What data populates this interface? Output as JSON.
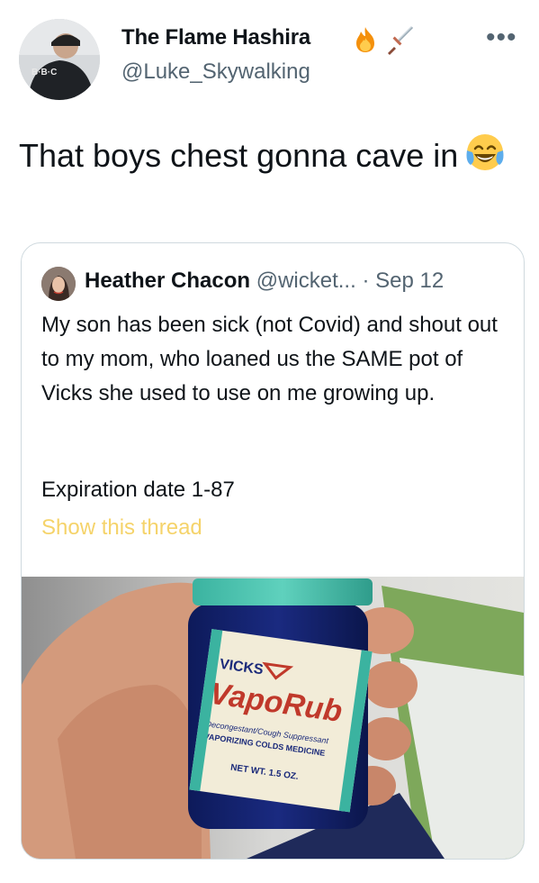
{
  "tweet": {
    "author": {
      "name": "The Flame Hashira",
      "handle": "@Luke_Skywalking",
      "name_emojis": [
        "fire-emoji",
        "dagger-emoji"
      ],
      "avatar_text": "B·B·C"
    },
    "more_label": "•••",
    "text": "That boys chest gonna cave in",
    "text_emoji": "face-with-tears-of-joy-emoji"
  },
  "quoted": {
    "name": "Heather Chacon",
    "handle": "@wicket...",
    "date": "· Sep 12",
    "body": "My son has been sick (not Covid) and shout out to my mom, who loaned us the SAME pot of Vicks she used to use on me growing up.",
    "expiration": "Expiration date 1-87",
    "show_thread": "Show this thread",
    "image_label": {
      "brand": "VICKS",
      "product": "VapoRub",
      "line1": "Decongestant/Cough Suppressant",
      "line2": "VAPORIZING COLDS MEDICINE",
      "net": "NET WT. 1.5 OZ."
    }
  },
  "colors": {
    "text": "#0f1419",
    "secondary": "#536471",
    "show_thread": "#f5d36a",
    "card_border": "#cfd9de"
  }
}
